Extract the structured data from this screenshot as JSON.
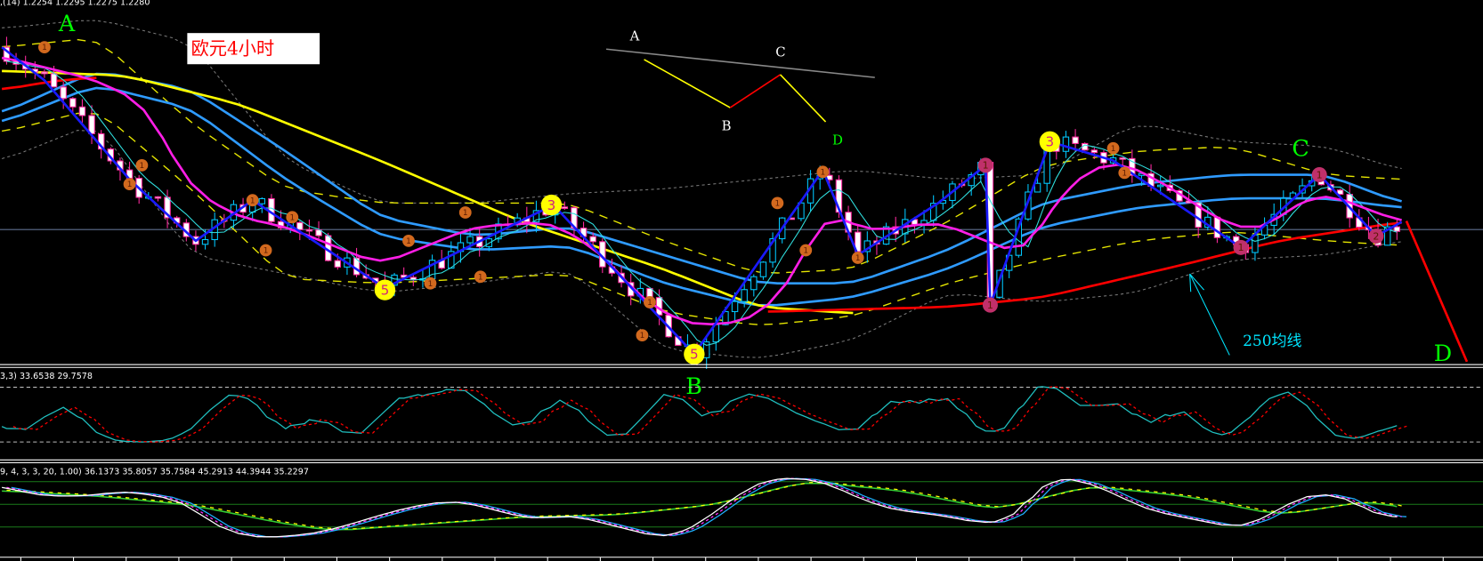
{
  "header": {
    "main_values": ",(14) 1.2254 1.2295 1.2275 1.2280",
    "stoch_label": "3,3) 33.6538 29.7578",
    "osc_label": "9, 4, 3, 3, 20, 1.00) 36.1373 35.8057 35.7584 45.2913 44.3944 35.2297"
  },
  "annotations": {
    "title_box": "欧元4小时",
    "wave_A": "A",
    "wave_B": "B",
    "wave_C": "C",
    "wave_D": "D",
    "ma250_label": "250均线",
    "sketch_A": "A",
    "sketch_B": "B",
    "sketch_C": "C",
    "sketch_D": "D"
  },
  "colors": {
    "background": "#000000",
    "bull": "#00c8ff",
    "bear": "#ff2aa0",
    "zigzag": "#1a1aff",
    "ma_long": "#ffff00",
    "ma250": "#ff0000",
    "ma_blue": "#2f9bff",
    "ma_fast": "#ff1ee6",
    "label_green": "#00ff00"
  },
  "chart_data": {
    "type": "candlestick",
    "symbol_title": "欧元4小时",
    "bars": 148,
    "price_range": [
      1.19,
      1.23
    ],
    "zigzag": [
      [
        0,
        1.225
      ],
      [
        4.5,
        1.2215
      ],
      [
        13.5,
        1.211
      ],
      [
        20.5,
        1.2045
      ],
      [
        26.5,
        1.2088
      ],
      [
        40.5,
        1.1995
      ],
      [
        58.3,
        1.2083
      ],
      [
        73.2,
        1.1925
      ],
      [
        86.8,
        1.212
      ],
      [
        90.5,
        1.203
      ],
      [
        99,
        1.2085
      ],
      [
        104,
        1.2125
      ],
      [
        104.5,
        1.1977
      ],
      [
        110.8,
        1.215
      ],
      [
        117.5,
        1.213
      ],
      [
        131,
        1.2038
      ],
      [
        139.3,
        1.2115
      ],
      [
        145.3,
        1.205
      ],
      [
        148,
        1.2065
      ]
    ],
    "ma_long_yellow": [
      [
        0,
        1.2225
      ],
      [
        13,
        1.222
      ],
      [
        25,
        1.219
      ],
      [
        40,
        1.213
      ],
      [
        55,
        1.2065
      ],
      [
        70,
        1.2015
      ],
      [
        80,
        1.1975
      ],
      [
        90.5,
        1.1968
      ]
    ],
    "ma250_red": [
      [
        [
          0,
          1.2205
        ],
        [
          6,
          1.2215
        ],
        [
          10,
          1.2218
        ]
      ],
      [
        [
          81,
          1.197
        ],
        [
          100,
          1.1975
        ],
        [
          110,
          1.1985
        ],
        [
          125,
          1.202
        ],
        [
          135,
          1.2045
        ],
        [
          148,
          1.2065
        ]
      ]
    ],
    "ma_blue_1": [
      [
        0,
        1.218
      ],
      [
        10,
        1.2225
      ],
      [
        20,
        1.2205
      ],
      [
        30,
        1.214
      ],
      [
        40,
        1.207
      ],
      [
        50,
        1.205
      ],
      [
        60,
        1.206
      ],
      [
        70,
        1.203
      ],
      [
        80,
        1.2
      ],
      [
        90,
        1.2
      ],
      [
        100,
        1.2035
      ],
      [
        110,
        1.2085
      ],
      [
        120,
        1.2105
      ],
      [
        130,
        1.2115
      ],
      [
        140,
        1.2115
      ],
      [
        148,
        1.2085
      ]
    ],
    "ma_blue_2": [
      [
        0,
        1.217
      ],
      [
        10,
        1.221
      ],
      [
        20,
        1.2185
      ],
      [
        30,
        1.211
      ],
      [
        40,
        1.205
      ],
      [
        50,
        1.2035
      ],
      [
        60,
        1.204
      ],
      [
        70,
        1.2
      ],
      [
        80,
        1.1975
      ],
      [
        90,
        1.1985
      ],
      [
        100,
        1.2015
      ],
      [
        110,
        1.206
      ],
      [
        120,
        1.208
      ],
      [
        130,
        1.209
      ],
      [
        140,
        1.209
      ],
      [
        148,
        1.208
      ]
    ],
    "bollinger_upper": [
      [
        0,
        1.227
      ],
      [
        10,
        1.228
      ],
      [
        20,
        1.2255
      ],
      [
        30,
        1.213
      ],
      [
        40,
        1.2085
      ],
      [
        50,
        1.2085
      ],
      [
        60,
        1.2095
      ],
      [
        70,
        1.21
      ],
      [
        80,
        1.211
      ],
      [
        90,
        1.212
      ],
      [
        100,
        1.211
      ],
      [
        110,
        1.2115
      ],
      [
        120,
        1.217
      ],
      [
        130,
        1.215
      ],
      [
        140,
        1.2145
      ],
      [
        148,
        1.212
      ]
    ],
    "bollinger_lower": [
      [
        0,
        1.213
      ],
      [
        10,
        1.217
      ],
      [
        20,
        1.203
      ],
      [
        30,
        1.201
      ],
      [
        40,
        1.199
      ],
      [
        50,
        1.2
      ],
      [
        60,
        1.2015
      ],
      [
        70,
        1.193
      ],
      [
        80,
        1.192
      ],
      [
        90,
        1.194
      ],
      [
        100,
        1.199
      ],
      [
        110,
        1.198
      ],
      [
        120,
        1.199
      ],
      [
        130,
        1.2025
      ],
      [
        140,
        1.203
      ],
      [
        148,
        1.2045
      ]
    ],
    "envelope_upper": [
      [
        0,
        1.225
      ],
      [
        10,
        1.226
      ],
      [
        20,
        1.217
      ],
      [
        30,
        1.21
      ],
      [
        40,
        1.2085
      ],
      [
        50,
        1.2085
      ],
      [
        60,
        1.2085
      ],
      [
        70,
        1.2045
      ],
      [
        80,
        1.201
      ],
      [
        90,
        1.2015
      ],
      [
        100,
        1.2065
      ],
      [
        110,
        1.2125
      ],
      [
        120,
        1.214
      ],
      [
        130,
        1.2145
      ],
      [
        140,
        1.2115
      ],
      [
        148,
        1.211
      ]
    ],
    "envelope_lower": [
      [
        0,
        1.216
      ],
      [
        10,
        1.2185
      ],
      [
        20,
        1.21
      ],
      [
        30,
        1.2005
      ],
      [
        40,
        1.2
      ],
      [
        50,
        1.2005
      ],
      [
        60,
        1.201
      ],
      [
        70,
        1.197
      ],
      [
        80,
        1.1955
      ],
      [
        90,
        1.1965
      ],
      [
        100,
        1.2
      ],
      [
        110,
        1.2025
      ],
      [
        120,
        1.2045
      ],
      [
        130,
        1.2055
      ],
      [
        140,
        1.2045
      ],
      [
        148,
        1.204
      ]
    ],
    "ma_fast_magenta": [
      [
        0,
        1.224
      ],
      [
        6,
        1.2225
      ],
      [
        10,
        1.2215
      ],
      [
        15,
        1.219
      ],
      [
        20,
        1.21
      ],
      [
        25,
        1.207
      ],
      [
        30,
        1.206
      ],
      [
        35,
        1.204
      ],
      [
        40,
        1.202
      ],
      [
        45,
        1.204
      ],
      [
        50,
        1.206
      ],
      [
        58,
        1.2065
      ],
      [
        63,
        1.2035
      ],
      [
        68,
        1.198
      ],
      [
        73,
        1.1955
      ],
      [
        79,
        1.196
      ],
      [
        83,
        1.1995
      ],
      [
        87,
        1.2075
      ],
      [
        92,
        1.2055
      ],
      [
        99,
        1.2065
      ],
      [
        104,
        1.2045
      ],
      [
        108,
        1.203
      ],
      [
        111,
        1.208
      ],
      [
        114,
        1.2115
      ],
      [
        118,
        1.213
      ],
      [
        123,
        1.2105
      ],
      [
        129,
        1.2065
      ],
      [
        133,
        1.2055
      ],
      [
        137,
        1.2085
      ],
      [
        140,
        1.2095
      ],
      [
        144,
        1.208
      ],
      [
        148,
        1.2065
      ]
    ],
    "reference_level": 1.2057,
    "markers": [
      {
        "bar": 58.1,
        "price": 1.2083,
        "label": "3",
        "kind": "major"
      },
      {
        "bar": 40.5,
        "price": 1.1993,
        "label": "5",
        "kind": "major"
      },
      {
        "bar": 73.2,
        "price": 1.1925,
        "label": "5",
        "kind": "major"
      },
      {
        "bar": 110.8,
        "price": 1.215,
        "label": "3",
        "kind": "major"
      },
      {
        "bar": 4.5,
        "price": 1.225,
        "label": "1",
        "kind": "minor"
      },
      {
        "bar": 13.5,
        "price": 1.2105,
        "label": "1",
        "kind": "minor"
      },
      {
        "bar": 14.8,
        "price": 1.2125,
        "label": "1",
        "kind": "minor"
      },
      {
        "bar": 26.5,
        "price": 1.2088,
        "label": "1",
        "kind": "minor"
      },
      {
        "bar": 27.9,
        "price": 1.2035,
        "label": "1",
        "kind": "minor"
      },
      {
        "bar": 30.7,
        "price": 1.207,
        "label": "1",
        "kind": "minor"
      },
      {
        "bar": 43,
        "price": 1.2045,
        "label": "1",
        "kind": "minor"
      },
      {
        "bar": 45.3,
        "price": 1.2,
        "label": "1",
        "kind": "minor"
      },
      {
        "bar": 49,
        "price": 1.2075,
        "label": "1",
        "kind": "minor"
      },
      {
        "bar": 50.6,
        "price": 1.2007,
        "label": "1",
        "kind": "minor"
      },
      {
        "bar": 68.5,
        "price": 1.198,
        "label": "1",
        "kind": "minor"
      },
      {
        "bar": 67.7,
        "price": 1.1945,
        "label": "1",
        "kind": "minor"
      },
      {
        "bar": 82,
        "price": 1.2085,
        "label": "1",
        "kind": "minor"
      },
      {
        "bar": 85,
        "price": 1.2035,
        "label": "1",
        "kind": "minor"
      },
      {
        "bar": 86.8,
        "price": 1.2118,
        "label": "1",
        "kind": "minor"
      },
      {
        "bar": 90.5,
        "price": 1.2027,
        "label": "1",
        "kind": "minor"
      },
      {
        "bar": 117.5,
        "price": 1.2143,
        "label": "1",
        "kind": "minor"
      },
      {
        "bar": 118.7,
        "price": 1.2117,
        "label": "1",
        "kind": "minor"
      },
      {
        "bar": 104,
        "price": 1.2125,
        "label": "1",
        "kind": "pink"
      },
      {
        "bar": 104.5,
        "price": 1.1977,
        "label": "1",
        "kind": "pink"
      },
      {
        "bar": 131,
        "price": 1.2038,
        "label": "1",
        "kind": "pink"
      },
      {
        "bar": 139.3,
        "price": 1.2115,
        "label": "1",
        "kind": "pink"
      },
      {
        "bar": 145.3,
        "price": 1.205,
        "label": "2",
        "kind": "pink"
      }
    ],
    "stochastic": {
      "levels": [
        80,
        20
      ],
      "main": [
        [
          0,
          40
        ],
        [
          2.5,
          25
        ],
        [
          6.5,
          70
        ],
        [
          10,
          25
        ],
        [
          13,
          20
        ],
        [
          17,
          20
        ],
        [
          20,
          30
        ],
        [
          24,
          80
        ],
        [
          27,
          65
        ],
        [
          30,
          20
        ],
        [
          32.5,
          55
        ],
        [
          36,
          30
        ],
        [
          38,
          20
        ],
        [
          42,
          78
        ],
        [
          44.5,
          65
        ],
        [
          47,
          80
        ],
        [
          49,
          82
        ],
        [
          52,
          50
        ],
        [
          54,
          35
        ],
        [
          56,
          35
        ],
        [
          59,
          80
        ],
        [
          62,
          40
        ],
        [
          64,
          25
        ],
        [
          66,
          20
        ],
        [
          70,
          80
        ],
        [
          72,
          78
        ],
        [
          74,
          30
        ],
        [
          77,
          70
        ],
        [
          79,
          75
        ],
        [
          81,
          70
        ],
        [
          84,
          50
        ],
        [
          87,
          40
        ],
        [
          90.5,
          25
        ],
        [
          94,
          75
        ],
        [
          97,
          55
        ],
        [
          100,
          80
        ],
        [
          103,
          30
        ],
        [
          106,
          25
        ],
        [
          109.5,
          92
        ],
        [
          112,
          80
        ],
        [
          114,
          50
        ],
        [
          118,
          70
        ],
        [
          121.5,
          30
        ],
        [
          125,
          70
        ],
        [
          127,
          25
        ],
        [
          130,
          25
        ],
        [
          133,
          60
        ],
        [
          136,
          85
        ],
        [
          138,
          60
        ],
        [
          141,
          20
        ],
        [
          144,
          25
        ],
        [
          147.5,
          40
        ]
      ]
    },
    "oscillator": {
      "levels": [
        80,
        50,
        20
      ],
      "fast": [
        [
          0,
          74
        ],
        [
          4,
          61
        ],
        [
          9,
          61
        ],
        [
          13,
          68
        ],
        [
          19,
          55
        ],
        [
          23,
          18
        ],
        [
          27,
          5
        ],
        [
          33,
          11
        ],
        [
          37,
          24
        ],
        [
          40,
          36
        ],
        [
          44,
          49
        ],
        [
          48,
          55
        ],
        [
          52,
          43
        ],
        [
          56,
          30
        ],
        [
          60,
          36
        ],
        [
          64,
          24
        ],
        [
          68,
          11
        ],
        [
          70,
          5
        ],
        [
          73,
          18
        ],
        [
          77,
          55
        ],
        [
          80,
          80
        ],
        [
          83,
          86
        ],
        [
          87,
          80
        ],
        [
          90,
          61
        ],
        [
          94,
          43
        ],
        [
          99,
          36
        ],
        [
          104,
          24
        ],
        [
          107,
          30
        ],
        [
          110,
          80
        ],
        [
          113,
          86
        ],
        [
          117,
          68
        ],
        [
          121,
          43
        ],
        [
          126,
          30
        ],
        [
          131,
          18
        ],
        [
          134,
          36
        ],
        [
          138,
          64
        ],
        [
          142,
          61
        ],
        [
          145,
          36
        ],
        [
          147.5,
          33
        ]
      ],
      "slow": [
        [
          0,
          68
        ],
        [
          10,
          61
        ],
        [
          20,
          49
        ],
        [
          30,
          24
        ],
        [
          35,
          15
        ],
        [
          45,
          24
        ],
        [
          55,
          33
        ],
        [
          65,
          36
        ],
        [
          75,
          49
        ],
        [
          85,
          80
        ],
        [
          95,
          68
        ],
        [
          105,
          43
        ],
        [
          115,
          74
        ],
        [
          125,
          61
        ],
        [
          135,
          36
        ],
        [
          145,
          55
        ],
        [
          147.5,
          45
        ]
      ]
    }
  }
}
